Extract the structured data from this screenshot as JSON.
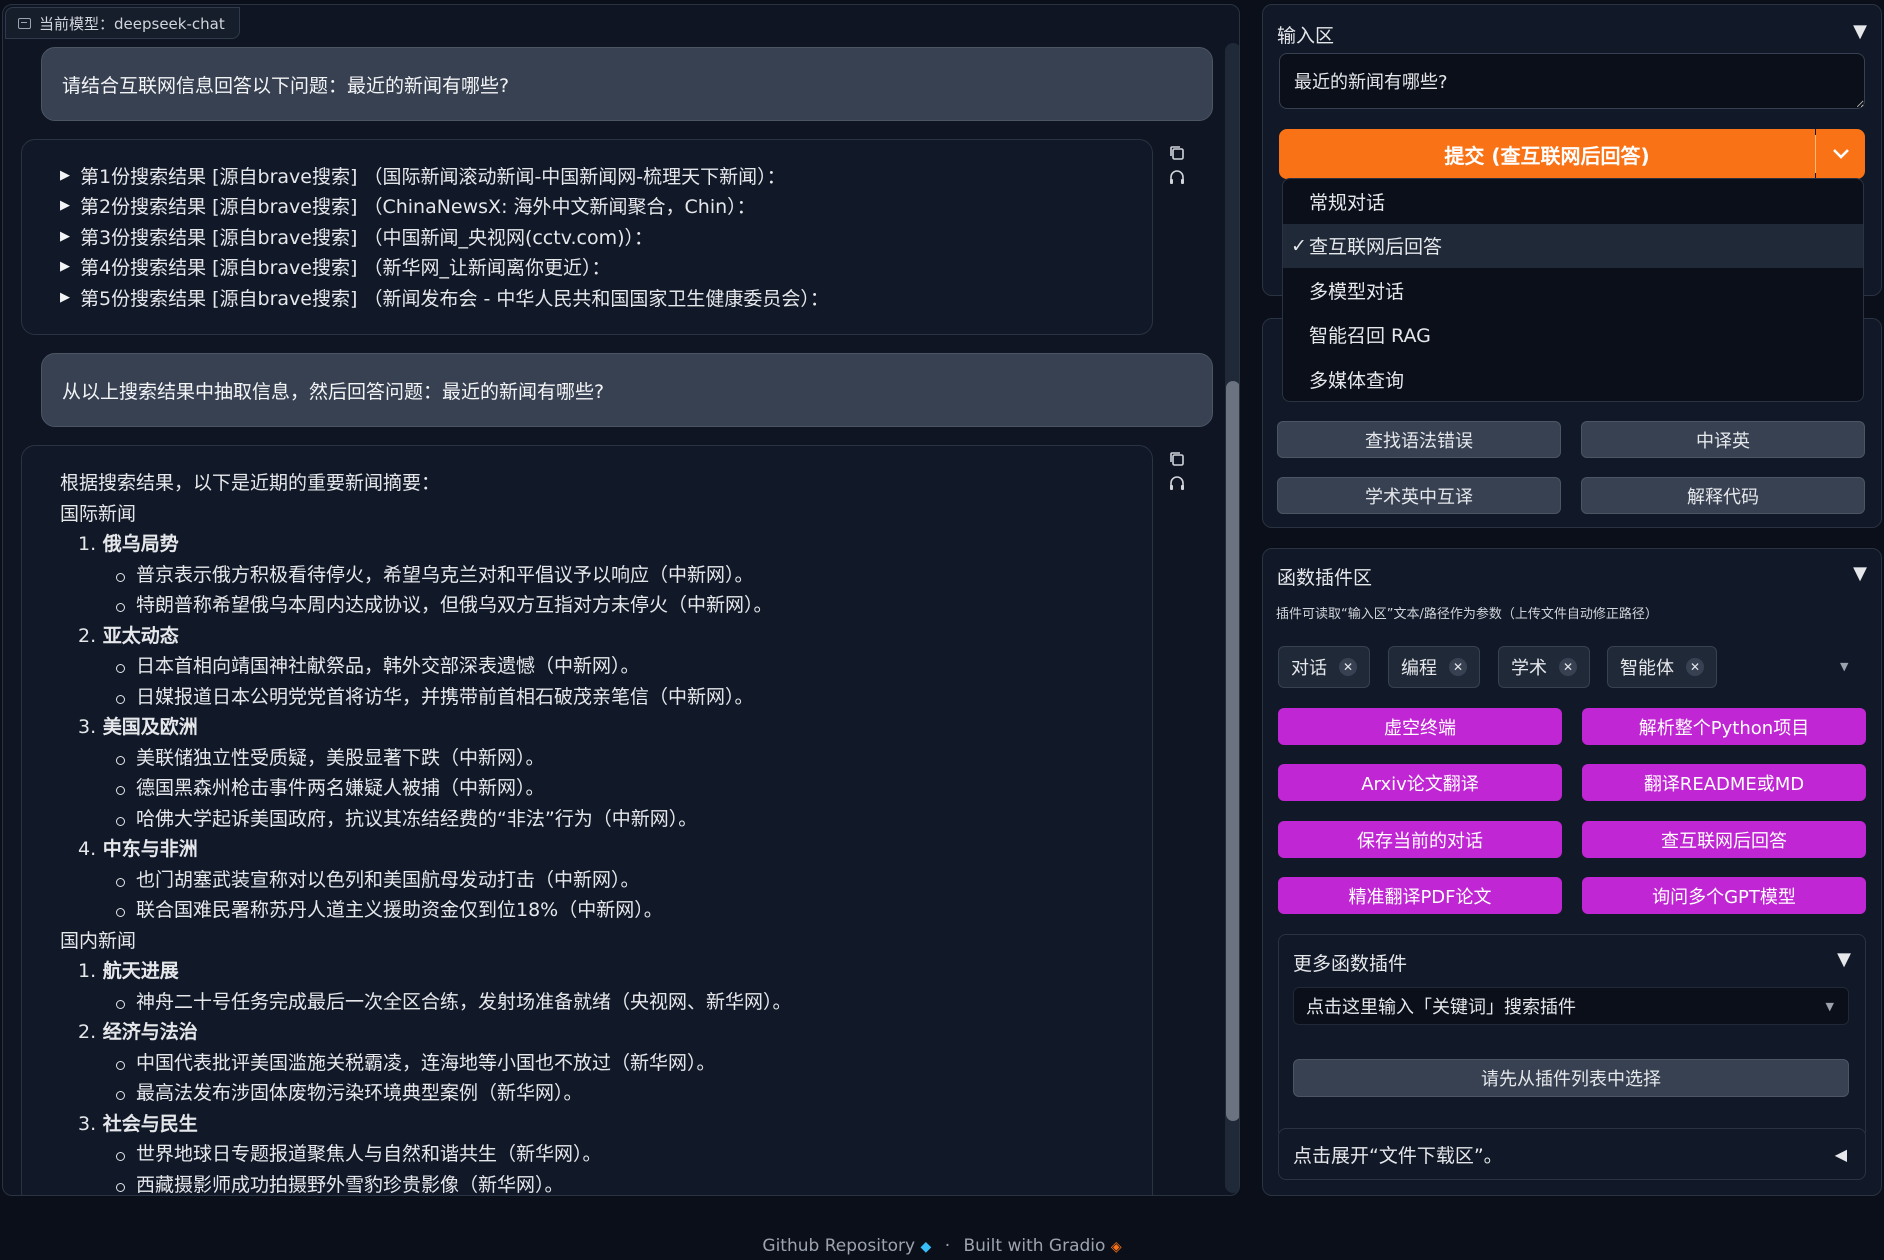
{
  "chat": {
    "model_label": "当前模型：deepseek-chat",
    "messages": [
      {
        "role": "user",
        "text": "请结合互联网信息回答以下问题：最近的新闻有哪些?"
      },
      {
        "role": "bot",
        "search_results": [
          "第1份搜索结果 [源自brave搜索] （国际新闻滚动新闻-中国新闻网-梳理天下新闻）：",
          "第2份搜索结果 [源自brave搜索] （ChinaNewsX: 海外中文新闻聚合，Chin）：",
          "第3份搜索结果 [源自brave搜索] （中国新闻_央视网(cctv.com)）：",
          "第4份搜索结果 [源自brave搜索] （新华网_让新闻离你更近）：",
          "第5份搜索结果 [源自brave搜索] （新闻发布会 - 中华人民共和国国家卫生健康委员会）："
        ]
      },
      {
        "role": "user",
        "text": "从以上搜索结果中抽取信息，然后回答问题：最近的新闻有哪些?"
      },
      {
        "role": "bot",
        "intro": "根据搜索结果，以下是近期的重要新闻摘要：",
        "sections": [
          {
            "title": "国际新闻",
            "topics": [
              {
                "num": "1.",
                "title": "俄乌局势",
                "items": [
                  "普京表示俄方积极看待停火，希望乌克兰对和平倡议予以响应（中新网）。",
                  "特朗普称希望俄乌本周内达成协议，但俄乌双方互指对方未停火（中新网）。"
                ]
              },
              {
                "num": "2.",
                "title": "亚太动态",
                "items": [
                  "日本首相向靖国神社献祭品，韩外交部深表遗憾（中新网）。",
                  "日媒报道日本公明党党首将访华，并携带前首相石破茂亲笔信（中新网）。"
                ]
              },
              {
                "num": "3.",
                "title": "美国及欧洲",
                "items": [
                  "美联储独立性受质疑，美股显著下跌（中新网）。",
                  "德国黑森州枪击事件两名嫌疑人被捕（中新网）。",
                  "哈佛大学起诉美国政府，抗议其冻结经费的“非法”行为（中新网）。"
                ]
              },
              {
                "num": "4.",
                "title": "中东与非洲",
                "items": [
                  "也门胡塞武装宣称对以色列和美国航母发动打击（中新网）。",
                  "联合国难民署称苏丹人道主义援助资金仅到位18%（中新网）。"
                ]
              }
            ]
          },
          {
            "title": "国内新闻",
            "topics": [
              {
                "num": "1.",
                "title": "航天进展",
                "items": [
                  "神舟二十号任务完成最后一次全区合练，发射场准备就绪（央视网、新华网）。"
                ]
              },
              {
                "num": "2.",
                "title": "经济与法治",
                "items": [
                  "中国代表批评美国滥施关税霸凌，连海地等小国也不放过（新华网）。",
                  "最高法发布涉固体废物污染环境典型案例（新华网）。"
                ]
              },
              {
                "num": "3.",
                "title": "社会与民生",
                "items": [
                  "世界地球日专题报道聚焦人与自然和谐共生（新华网）。",
                  "西藏摄影师成功拍摄野外雪豹珍贵影像（新华网）。"
                ]
              }
            ]
          }
        ]
      }
    ]
  },
  "input_area": {
    "title": "输入区",
    "collapse_icon": "▼",
    "input_value": "最近的新闻有哪些?",
    "submit_label": "提交 (查互联网后回答)",
    "mode_options": [
      "常规对话",
      "查互联网后回答",
      "多模型对话",
      "智能召回 RAG",
      "多媒体查询"
    ],
    "selected_mode": "查互联网后回答",
    "check_mark": "✓"
  },
  "basic_functions": {
    "buttons": [
      "查找语法错误",
      "中译英",
      "学术英中互译",
      "解释代码"
    ]
  },
  "plugin_area": {
    "title": "函数插件区",
    "collapse_icon": "▼",
    "hint": "插件可读取“输入区”文本/路径作为参数（上传文件自动修正路径）",
    "categories": [
      "对话",
      "编程",
      "学术",
      "智能体"
    ],
    "buttons": [
      "虚空终端",
      "解析整个Python项目",
      "Arxiv论文翻译",
      "翻译README或MD",
      "保存当前的对话",
      "查互联网后回答",
      "精准翻译PDF论文",
      "询问多个GPT模型"
    ],
    "more": {
      "title": "更多函数插件",
      "collapse_icon": "▼",
      "search_placeholder": "点击这里输入「关键词」搜索插件",
      "select_button": "请先从插件列表中选择"
    }
  },
  "download_area": {
    "label": "点击展开“文件下载区”。",
    "expand_icon": "◀"
  },
  "footer": {
    "github": "Github Repository",
    "separator": "·",
    "built_with": "Built with Gradio"
  },
  "colors": {
    "accent_orange": "#f97316",
    "plugin_purple": "#c026d3",
    "background": "#0b0f19"
  }
}
